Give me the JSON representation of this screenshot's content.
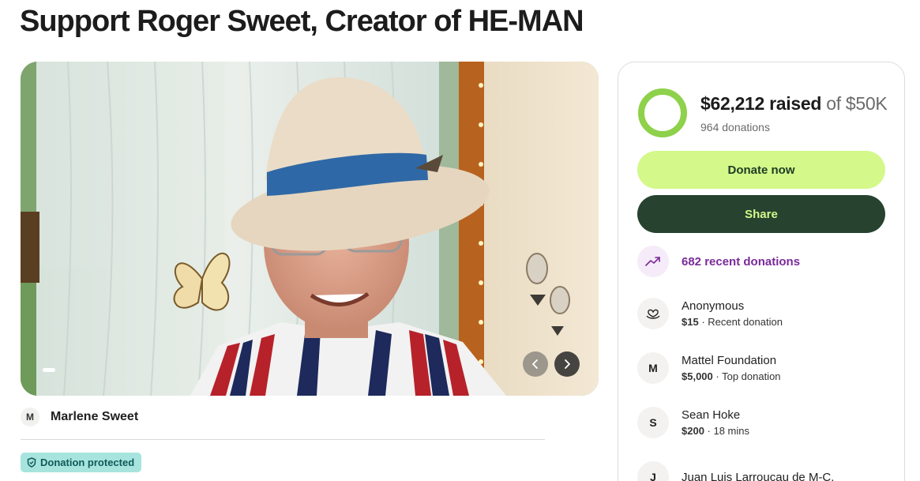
{
  "page": {
    "title": "Support Roger Sweet, Creator of HE-MAN"
  },
  "carousel": {
    "prev_icon": "chevron-left-icon",
    "next_icon": "chevron-right-icon"
  },
  "organizer": {
    "initial": "M",
    "name": "Marlene Sweet"
  },
  "badge": {
    "label": "Donation protected",
    "icon": "shield-icon"
  },
  "fundraiser": {
    "raised": "$62,212 raised",
    "goal": "of $50K",
    "donations": "964 donations",
    "progress_fraction": 1.0,
    "donate_label": "Donate now",
    "share_label": "Share",
    "recent_label": "682 recent donations"
  },
  "donors": [
    {
      "name": "Anonymous",
      "initial": "",
      "icon": "heart-hand-icon",
      "amount": "$15",
      "meta": " · Recent donation"
    },
    {
      "name": "Mattel Foundation",
      "initial": "M",
      "amount": "$5,000",
      "meta": " · Top donation"
    },
    {
      "name": "Sean Hoke",
      "initial": "S",
      "amount": "$200",
      "meta": " · 18 mins"
    },
    {
      "name": "Juan Luis Larroucau de M-C.",
      "initial": "J",
      "amount": "",
      "meta": ""
    }
  ],
  "colors": {
    "donate_bg": "#d4f88a",
    "share_bg": "#274330",
    "progress": "#8ed14a",
    "recent_accent": "#7a2a9a",
    "badge_bg": "#a7e4de"
  }
}
